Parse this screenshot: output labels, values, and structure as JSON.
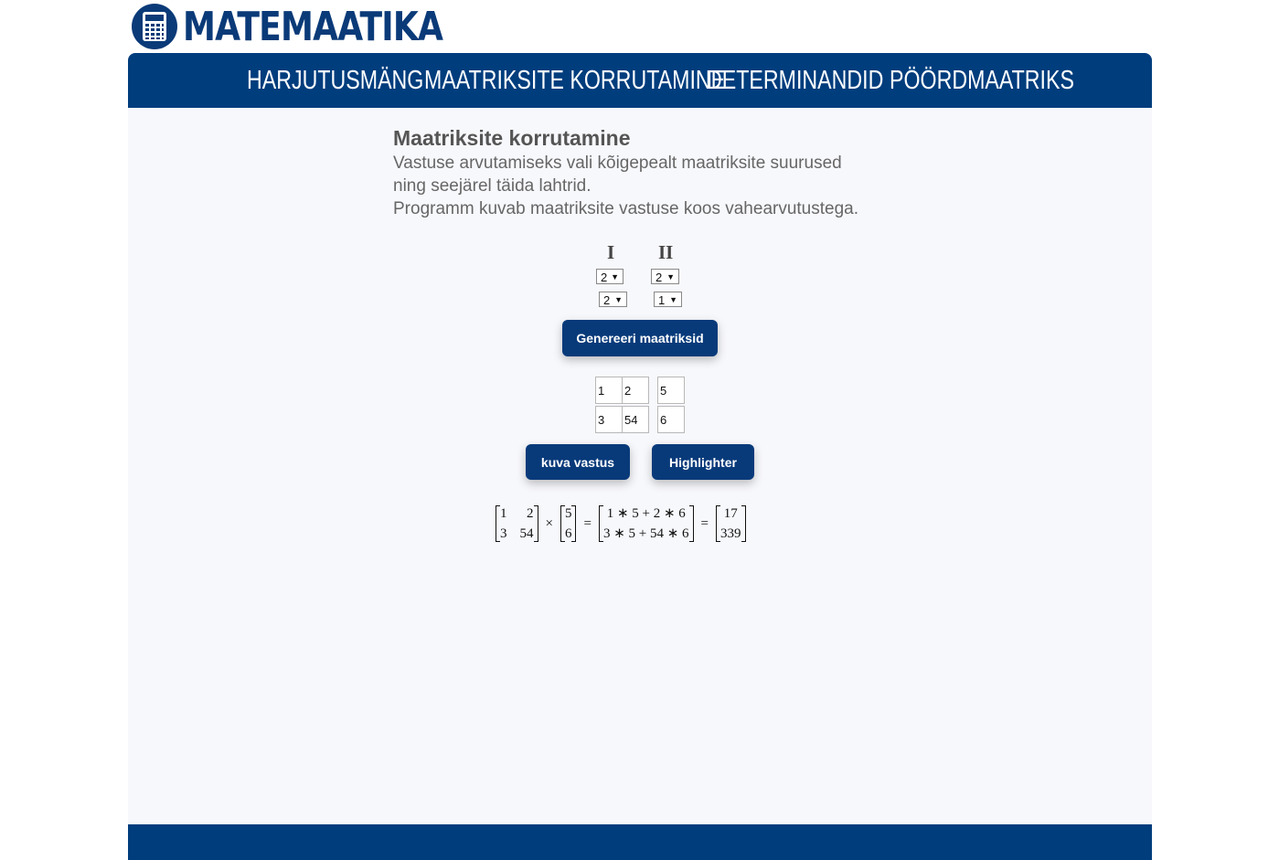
{
  "brand": {
    "name": "MATEMAATIKA",
    "icon": "calculator-icon"
  },
  "nav": {
    "items": [
      {
        "label": "HARJUTUSMÄNG"
      },
      {
        "label": "MAATRIKSITE KORRUTAMINE"
      },
      {
        "label": "DETERMINANDID"
      },
      {
        "label": "PÖÖRDMAATRIKS"
      }
    ]
  },
  "main": {
    "title": "Maatriksite korrutamine",
    "description": [
      "Vastuse arvutamiseks vali kõigepealt maatriksite suurused",
      "ning seejärel täida lahtrid.",
      "Programm kuvab maatriksite vastuse koos vahearvutustega."
    ]
  },
  "matrix_sizes": {
    "first": {
      "label": "I",
      "rows": "2",
      "cols": "2"
    },
    "second": {
      "label": "II",
      "rows": "2",
      "cols": "1"
    }
  },
  "buttons": {
    "generate": "Genereeri maatriksid",
    "show_answer": "kuva vastus",
    "highlighter": "Highlighter"
  },
  "inputs": {
    "matrix_a": [
      [
        "1",
        "2"
      ],
      [
        "3",
        "54"
      ]
    ],
    "matrix_b": [
      [
        "5"
      ],
      [
        "6"
      ]
    ]
  },
  "result": {
    "a": [
      [
        "1",
        "2"
      ],
      [
        "3",
        "54"
      ]
    ],
    "times": "×",
    "b": [
      [
        "5"
      ],
      [
        "6"
      ]
    ],
    "equals": "=",
    "steps": [
      "1 ∗ 5 + 2 ∗ 6",
      "3 ∗ 5 + 54 ∗ 6"
    ],
    "answer": [
      "17",
      "339"
    ]
  },
  "colors": {
    "brand": "#003d7d",
    "panel": "#f7f8fc"
  }
}
